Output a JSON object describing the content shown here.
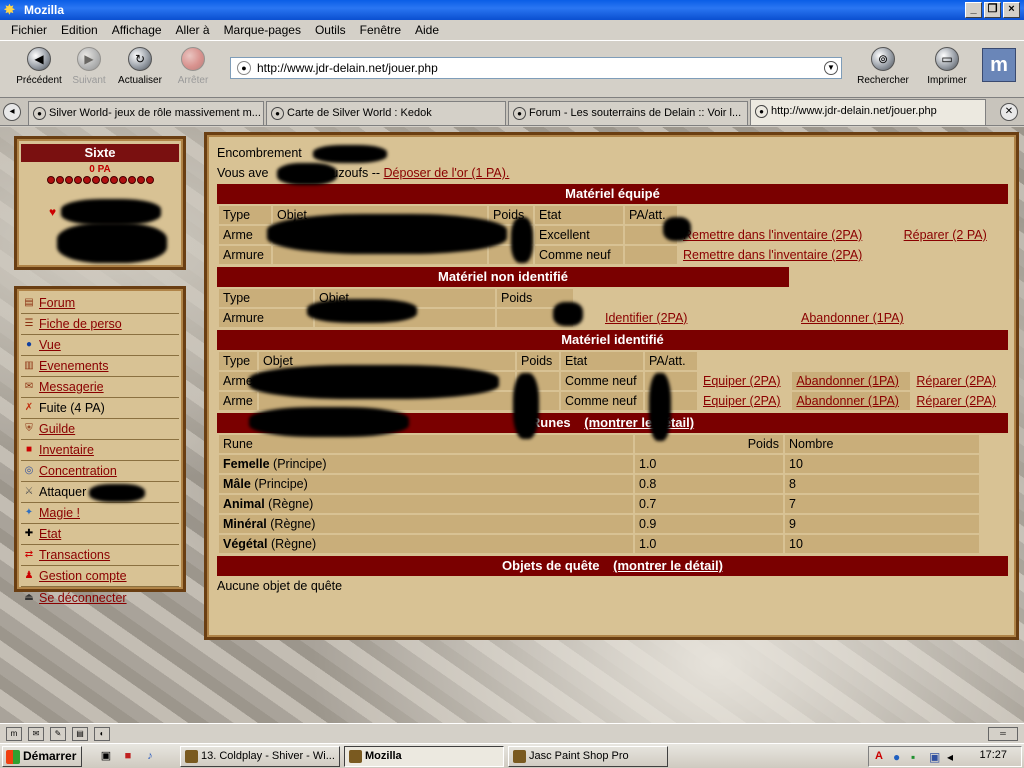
{
  "window": {
    "title": "Mozilla"
  },
  "menubar": [
    "Fichier",
    "Edition",
    "Affichage",
    "Aller à",
    "Marque-pages",
    "Outils",
    "Fenêtre",
    "Aide"
  ],
  "toolbar": {
    "back": "Précédent",
    "forward": "Suivant",
    "reload": "Actualiser",
    "stop": "Arrêter",
    "search": "Rechercher",
    "print": "Imprimer",
    "url": "http://www.jdr-delain.net/jouer.php"
  },
  "tabs": [
    "Silver World- jeux de rôle massivement m...",
    "Carte de Silver World : Kedok",
    "Forum - Les souterrains de Delain :: Voir l...",
    "http://www.jdr-delain.net/jouer.php"
  ],
  "character": {
    "name": "Sixte",
    "pa": "0 PA"
  },
  "menu": [
    {
      "label": "Forum",
      "link": true
    },
    {
      "label": "Fiche de perso",
      "link": true
    },
    {
      "label": "Vue",
      "link": true
    },
    {
      "label": "Evenements",
      "link": true
    },
    {
      "label": "Messagerie",
      "link": true
    },
    {
      "label": "Fuite (4 PA)",
      "link": false
    },
    {
      "label": "Guilde",
      "link": true
    },
    {
      "label": "Inventaire",
      "link": true
    },
    {
      "label": "Concentration",
      "link": true
    },
    {
      "label": "Attaquer",
      "link": false
    },
    {
      "label": "Magie !",
      "link": true
    },
    {
      "label": "Etat",
      "link": true
    },
    {
      "label": "Transactions",
      "link": true
    },
    {
      "label": "Gestion compte",
      "link": true
    },
    {
      "label": "Se déconnecter",
      "link": true
    }
  ],
  "main": {
    "encumbrance_label": "Encombrement",
    "gold_prefix": "Vous ave",
    "gold_suffix": "ouzoufs --",
    "gold_link": "Déposer de l'or (1 PA).",
    "equipped": {
      "title": "Matériel équipé",
      "headers": [
        "Type",
        "Objet",
        "Poids",
        "Etat",
        "PA/att."
      ],
      "rows": [
        {
          "type": "Arme",
          "etat": "Excellent",
          "link1": "Remettre dans l'inventaire (2PA)",
          "link2": "Réparer (2 PA)"
        },
        {
          "type": "Armure",
          "etat": "Comme neuf",
          "link1": "Remettre dans l'inventaire (2PA)"
        }
      ]
    },
    "unidentified": {
      "title": "Matériel non identifié",
      "headers": [
        "Type",
        "Objet",
        "Poids"
      ],
      "rows": [
        {
          "type": "Armure",
          "link1": "Identifier (2PA)",
          "link2": "Abandonner (1PA)"
        }
      ]
    },
    "identified": {
      "title": "Matériel identifié",
      "headers": [
        "Type",
        "Objet",
        "Poids",
        "Etat",
        "PA/att."
      ],
      "rows": [
        {
          "type": "Arme",
          "etat": "Comme neuf",
          "equip": "Equiper (2PA)",
          "drop": "Abandonner (1PA)",
          "repair": "Réparer (2PA)"
        },
        {
          "type": "Arme",
          "etat": "Comme neuf",
          "equip": "Equiper (2PA)",
          "drop": "Abandonner (1PA)",
          "repair": "Réparer (2PA)"
        }
      ]
    },
    "runes": {
      "title": "Runes",
      "detail_link": "(montrer le détail)",
      "headers": [
        "Rune",
        "Poids",
        "Nombre"
      ],
      "rows": [
        {
          "name": "Femelle",
          "kind": "(Principe)",
          "poids": "1.0",
          "nombre": "10"
        },
        {
          "name": "Mâle",
          "kind": "(Principe)",
          "poids": "0.8",
          "nombre": "8"
        },
        {
          "name": "Animal",
          "kind": "(Règne)",
          "poids": "0.7",
          "nombre": "7"
        },
        {
          "name": "Minéral",
          "kind": "(Règne)",
          "poids": "0.9",
          "nombre": "9"
        },
        {
          "name": "Végétal",
          "kind": "(Règne)",
          "poids": "1.0",
          "nombre": "10"
        }
      ]
    },
    "quest": {
      "title": "Objets de quête",
      "detail_link": "(montrer le détail)",
      "empty": "Aucune objet de quête"
    }
  },
  "taskbar": {
    "start": "Démarrer",
    "tasks": [
      "13. Coldplay - Shiver - Wi...",
      "Mozilla",
      "Jasc Paint Shop Pro"
    ],
    "clock": "17:27"
  }
}
